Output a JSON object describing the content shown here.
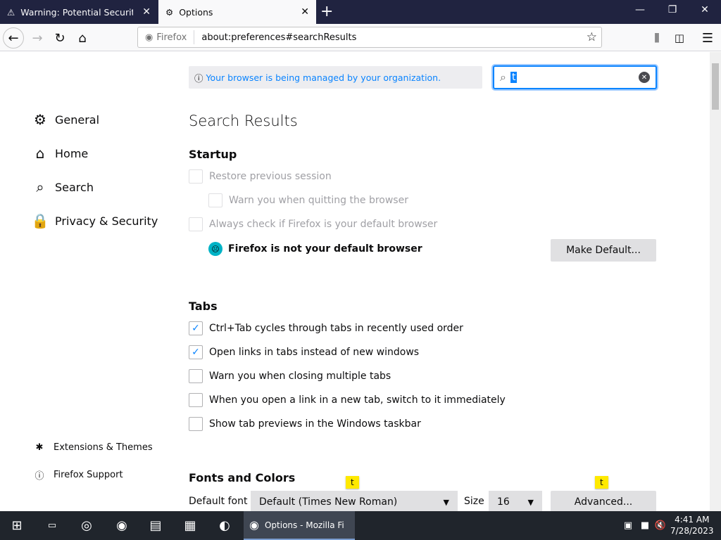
{
  "tabs": [
    {
      "title": "Warning: Potential Security Risk Ahead"
    },
    {
      "title": "Options"
    }
  ],
  "urlbar": {
    "identity": "Firefox",
    "url": "about:preferences#searchResults"
  },
  "sidebar": {
    "items": [
      {
        "label": "General",
        "icon": "gear-icon"
      },
      {
        "label": "Home",
        "icon": "home-icon"
      },
      {
        "label": "Search",
        "icon": "search-icon"
      },
      {
        "label": "Privacy & Security",
        "icon": "lock-icon"
      }
    ],
    "footer": [
      {
        "label": "Extensions & Themes",
        "icon": "puzzle-icon"
      },
      {
        "label": "Firefox Support",
        "icon": "help-icon"
      }
    ]
  },
  "notice": "Your browser is being managed by your organization.",
  "search": {
    "value": "t"
  },
  "main": {
    "title": "Search Results",
    "startup": {
      "heading": "Startup",
      "restore": "Restore previous session",
      "warn_quit": "Warn you when quitting the browser",
      "always_check": "Always check if Firefox is your default browser",
      "not_default": "Firefox is not your default browser",
      "make_default": "Make Default..."
    },
    "tabs_section": {
      "heading": "Tabs",
      "items": [
        {
          "label": "Ctrl+Tab cycles through tabs in recently used order",
          "checked": true
        },
        {
          "label": "Open links in tabs instead of new windows",
          "checked": true
        },
        {
          "label": "Warn you when closing multiple tabs",
          "checked": false
        },
        {
          "label": "When you open a link in a new tab, switch to it immediately",
          "checked": false
        },
        {
          "label": "Show tab previews in the Windows taskbar",
          "checked": false
        }
      ]
    },
    "fonts": {
      "heading": "Fonts and Colors",
      "default_font_label": "Default font",
      "default_font_value": "Default (Times New Roman)",
      "size_label": "Size",
      "size_value": "16",
      "advanced": "Advanced...",
      "tooltip": "t"
    }
  },
  "taskbar": {
    "active_app": "Options - Mozilla Firefox",
    "time": "4:41 AM",
    "date": "7/28/2023"
  }
}
